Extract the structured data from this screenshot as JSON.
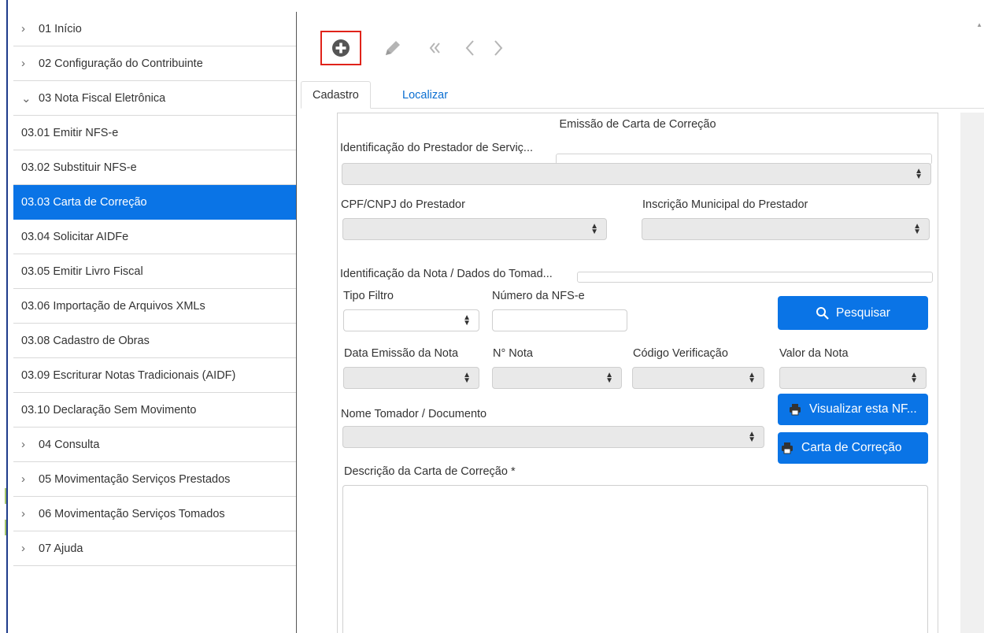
{
  "sidebar": {
    "items": [
      {
        "label": "01 Início",
        "chevron": ">"
      },
      {
        "label": "02 Configuração do Contribuinte",
        "chevron": ">"
      },
      {
        "label": "03 Nota Fiscal Eletrônica",
        "chevron": "⌄"
      },
      {
        "label": "03.01 Emitir NFS-e"
      },
      {
        "label": "03.02 Substituir NFS-e"
      },
      {
        "label": "03.03 Carta de Correção",
        "active": true
      },
      {
        "label": "03.04 Solicitar AIDFe"
      },
      {
        "label": "03.05 Emitir Livro Fiscal"
      },
      {
        "label": "03.06 Importação de Arquivos XMLs"
      },
      {
        "label": "03.08 Cadastro de Obras"
      },
      {
        "label": "03.09 Escriturar Notas Tradicionais (AIDF)"
      },
      {
        "label": "03.10 Declaração Sem Movimento"
      },
      {
        "label": "04 Consulta",
        "chevron": ">"
      },
      {
        "label": "05 Movimentação Serviços Prestados",
        "chevron": ">"
      },
      {
        "label": "06 Movimentação Serviços Tomados",
        "chevron": ">"
      },
      {
        "label": "07 Ajuda",
        "chevron": ">"
      }
    ]
  },
  "toolbar": {
    "icons": [
      "plus-circle-icon",
      "pencil-icon",
      "double-chevron-left-icon",
      "chevron-left-icon",
      "chevron-right-icon"
    ]
  },
  "tabs": {
    "cadastro": "Cadastro",
    "localizar": "Localizar"
  },
  "form": {
    "title": "Emissão de Carta de Correção",
    "section_prestador": "Identificação do Prestador de Serviç...",
    "cpf_label": "CPF/CNPJ do Prestador",
    "inscricao_label": "Inscrição Municipal do Prestador",
    "section_nota": "Identificação da Nota / Dados do Tomad...",
    "tipo_filtro_label": "Tipo Filtro",
    "numero_nfse_label": "Número da NFS-e",
    "pesquisar_button": "Pesquisar",
    "data_emissao_label": "Data Emissão da Nota",
    "numero_nota_label": "N° Nota",
    "codigo_verificacao_label": "Código Verificação",
    "valor_nota_label": "Valor da Nota",
    "visualizar_button": "Visualizar esta NF...",
    "nome_tomador_label": "Nome Tomador / Documento",
    "carta_button": "Carta de Correção",
    "descricao_label": "Descrição da Carta de Correção *"
  },
  "colors": {
    "primary": "#0a74e6",
    "add_highlight": "#e0231a",
    "link": "#0a6ed1"
  }
}
